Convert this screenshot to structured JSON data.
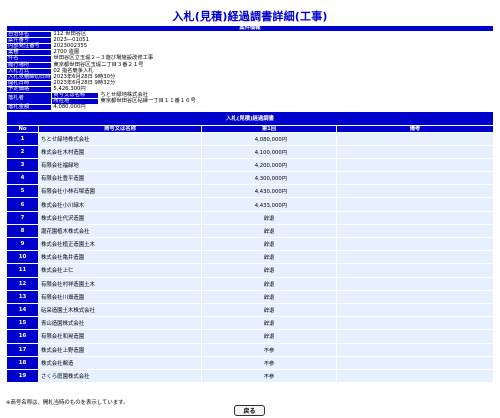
{
  "page": {
    "title": "入札(見積)経過調書詳細(工事)"
  },
  "case_info": {
    "section_title": "案件情報",
    "rows": [
      {
        "label": "自治体名",
        "value": "112 世田谷区"
      },
      {
        "label": "案件番号",
        "value": "2023―01051"
      },
      {
        "label": "内部発注番号",
        "value": "2023002355"
      },
      {
        "label": "業種",
        "value": "2700 造園"
      },
      {
        "label": "件名",
        "value": "世田谷区立玉堤２−３遊び場施設改修工事"
      },
      {
        "label": "履行場所",
        "value": "東京都世田谷区玉堤二丁目３番２１号"
      },
      {
        "label": "入札方式",
        "value": "02 指名競争入札"
      },
      {
        "label": "入札見積締切日時",
        "value": "2023年6月28日 9時30分"
      },
      {
        "label": "開札日時",
        "value": "2023年6月28日 9時32分"
      },
      {
        "label": "予定価格",
        "value": "5,426,300円"
      }
    ],
    "winner": {
      "label": "落札者",
      "sub1": "商号又は名称",
      "val1": "ちとせ緑地株式会社",
      "sub2": "所在地",
      "val2": "東京都世田谷区砧縁一丁目１１番１６号"
    },
    "amount": {
      "label": "落札金額",
      "value": "4,080,000円"
    }
  },
  "bid_list": {
    "section_title": "入札(見積)経過調書",
    "headers": {
      "no": "No",
      "name": "商号又は名称",
      "round1": "第1回",
      "note": "備考"
    },
    "rows": [
      {
        "no": "1",
        "name": "ちとせ緑地株式会社",
        "amount": "4,080,000円",
        "status": ""
      },
      {
        "no": "2",
        "name": "株式会社木村造園",
        "amount": "4,100,000円",
        "status": ""
      },
      {
        "no": "3",
        "name": "有限会社福緑地",
        "amount": "4,200,000円",
        "status": ""
      },
      {
        "no": "4",
        "name": "有限会社豊平造園",
        "amount": "4,300,000円",
        "status": ""
      },
      {
        "no": "5",
        "name": "有限会社小林石塚造園",
        "amount": "4,430,000円",
        "status": ""
      },
      {
        "no": "6",
        "name": "株式会社小川緑木",
        "amount": "4,433,000円",
        "status": ""
      },
      {
        "no": "7",
        "name": "株式会社代沢造園",
        "amount": "",
        "status": "辞退"
      },
      {
        "no": "8",
        "name": "瀧花園植木株式会社",
        "amount": "",
        "status": "辞退"
      },
      {
        "no": "9",
        "name": "株式会社植正造園土木",
        "amount": "",
        "status": "辞退"
      },
      {
        "no": "10",
        "name": "株式会社亀井造園",
        "amount": "",
        "status": "辞退"
      },
      {
        "no": "11",
        "name": "株式会社上仁",
        "amount": "",
        "status": "辞退"
      },
      {
        "no": "12",
        "name": "有限会社村祥造園土木",
        "amount": "",
        "status": "辞退"
      },
      {
        "no": "13",
        "name": "有限会社川畑造園",
        "amount": "",
        "status": "辞退"
      },
      {
        "no": "14",
        "name": "砧采造園土木株式会社",
        "amount": "",
        "status": "辞退"
      },
      {
        "no": "15",
        "name": "青山造園株式会社",
        "amount": "",
        "status": "辞退"
      },
      {
        "no": "16",
        "name": "有限会社和晃造園",
        "amount": "",
        "status": "辞退"
      },
      {
        "no": "17",
        "name": "株式会社上野造園",
        "amount": "",
        "status": "不参"
      },
      {
        "no": "18",
        "name": "株式会社鵜造",
        "amount": "",
        "status": "不参"
      },
      {
        "no": "19",
        "name": "さくら庭園株式会社",
        "amount": "",
        "status": "不参"
      }
    ]
  },
  "footer": {
    "note": "※商号名称は、開札当時のものを表示しています。",
    "back_label": "戻る"
  },
  "colors": {
    "header_bg": "#0000cc",
    "cell_bg": "#e6f0ff",
    "title": "#0000cc"
  }
}
